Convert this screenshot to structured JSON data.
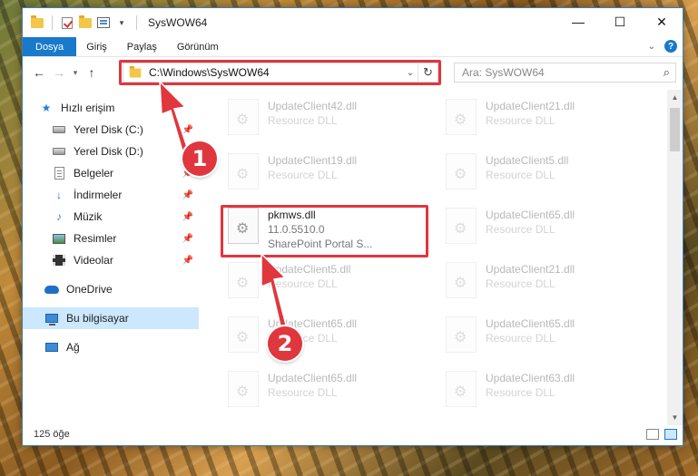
{
  "window": {
    "title": "SysWOW64",
    "controls": {
      "minimize": "—",
      "maximize": "☐",
      "close": "✕"
    }
  },
  "ribbon": {
    "tabs": [
      {
        "label": "Dosya",
        "active": true
      },
      {
        "label": "Giriş"
      },
      {
        "label": "Paylaş"
      },
      {
        "label": "Görünüm"
      }
    ],
    "help": "?"
  },
  "address": {
    "path": "C:\\Windows\\SysWOW64",
    "search_placeholder": "Ara: SysWOW64"
  },
  "sidebar": {
    "items": [
      {
        "label": "Hızlı erişim",
        "icon": "star-icon"
      },
      {
        "label": "Yerel Disk (C:)",
        "icon": "drive-icon",
        "pinned": true
      },
      {
        "label": "Yerel Disk (D:)",
        "icon": "drive-icon",
        "pinned": true
      },
      {
        "label": "Belgeler",
        "icon": "document-icon",
        "pinned": true
      },
      {
        "label": "İndirmeler",
        "icon": "download-icon",
        "pinned": true
      },
      {
        "label": "Müzik",
        "icon": "music-icon",
        "pinned": true
      },
      {
        "label": "Resimler",
        "icon": "pictures-icon",
        "pinned": true
      },
      {
        "label": "Videolar",
        "icon": "videos-icon",
        "pinned": true
      },
      {
        "label": "OneDrive",
        "icon": "onedrive-icon"
      },
      {
        "label": "Bu bilgisayar",
        "icon": "this-pc-icon",
        "selected": true
      },
      {
        "label": "Ağ",
        "icon": "network-icon"
      }
    ]
  },
  "files": [
    {
      "name": "UpdateClient42.dll",
      "desc": "Resource DLL"
    },
    {
      "name": "UpdateClient21.dll",
      "desc": "Resource DLL"
    },
    {
      "name": "UpdateClient19.dll",
      "desc": "Resource DLL"
    },
    {
      "name": "UpdateClient5.dll",
      "desc": "Resource DLL"
    },
    {
      "name": "pkmws.dll",
      "version": "11.0.5510.0",
      "desc": "SharePoint Portal S...",
      "highlighted": true
    },
    {
      "name": "UpdateClient65.dll",
      "desc": "Resource DLL"
    },
    {
      "name": "UpdateClient5.dll",
      "desc": "Resource DLL"
    },
    {
      "name": "UpdateClient21.dll",
      "desc": "Resource DLL"
    },
    {
      "name": "UpdateClient65.dll",
      "desc": "Resource DLL"
    },
    {
      "name": "UpdateClient65.dll",
      "desc": "Resource DLL"
    },
    {
      "name": "UpdateClient65.dll",
      "desc": "Resource DLL"
    },
    {
      "name": "UpdateClient63.dll",
      "desc": "Resource DLL"
    }
  ],
  "status": {
    "item_count": "125 öğe"
  },
  "annotations": {
    "step1": "1",
    "step2": "2",
    "color": "#e0363e"
  }
}
